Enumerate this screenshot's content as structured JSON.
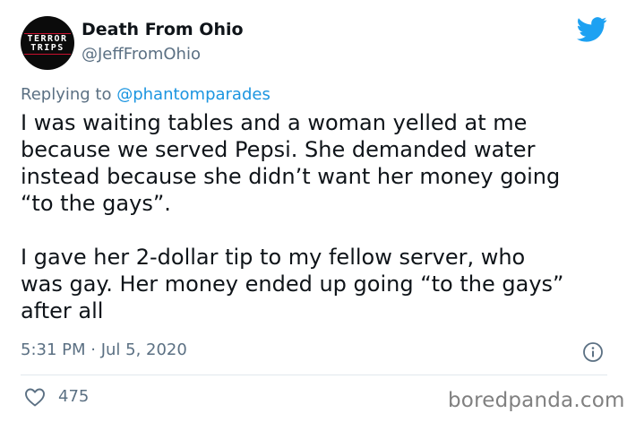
{
  "user": {
    "display_name": "Death From Ohio",
    "handle": "@JeffFromOhio",
    "avatar_text_line1": "TERROR",
    "avatar_text_line2": "TRIPS"
  },
  "reply": {
    "prefix": "Replying to ",
    "to": "@phantomparades"
  },
  "tweet": {
    "paragraph1": "I was waiting tables and a woman yelled at me\nbecause we served Pepsi.  She demanded water\ninstead because she didn’t want her money going\n“to the gays”.",
    "paragraph2": "I gave her 2-dollar tip to my fellow server, who\nwas gay.  Her money ended up going “to the gays”\nafter all"
  },
  "meta": {
    "timestamp": "5:31 PM · Jul 5, 2020"
  },
  "engagement": {
    "likes": "475"
  },
  "watermark": "boredpanda.com",
  "icons": {
    "brand": "twitter-bird-icon",
    "info": "info-icon",
    "like": "heart-icon"
  },
  "colors": {
    "twitter_blue": "#1da1f2",
    "link_blue": "#1b95e0",
    "secondary_text": "#5b7083",
    "text": "#0f1419"
  }
}
